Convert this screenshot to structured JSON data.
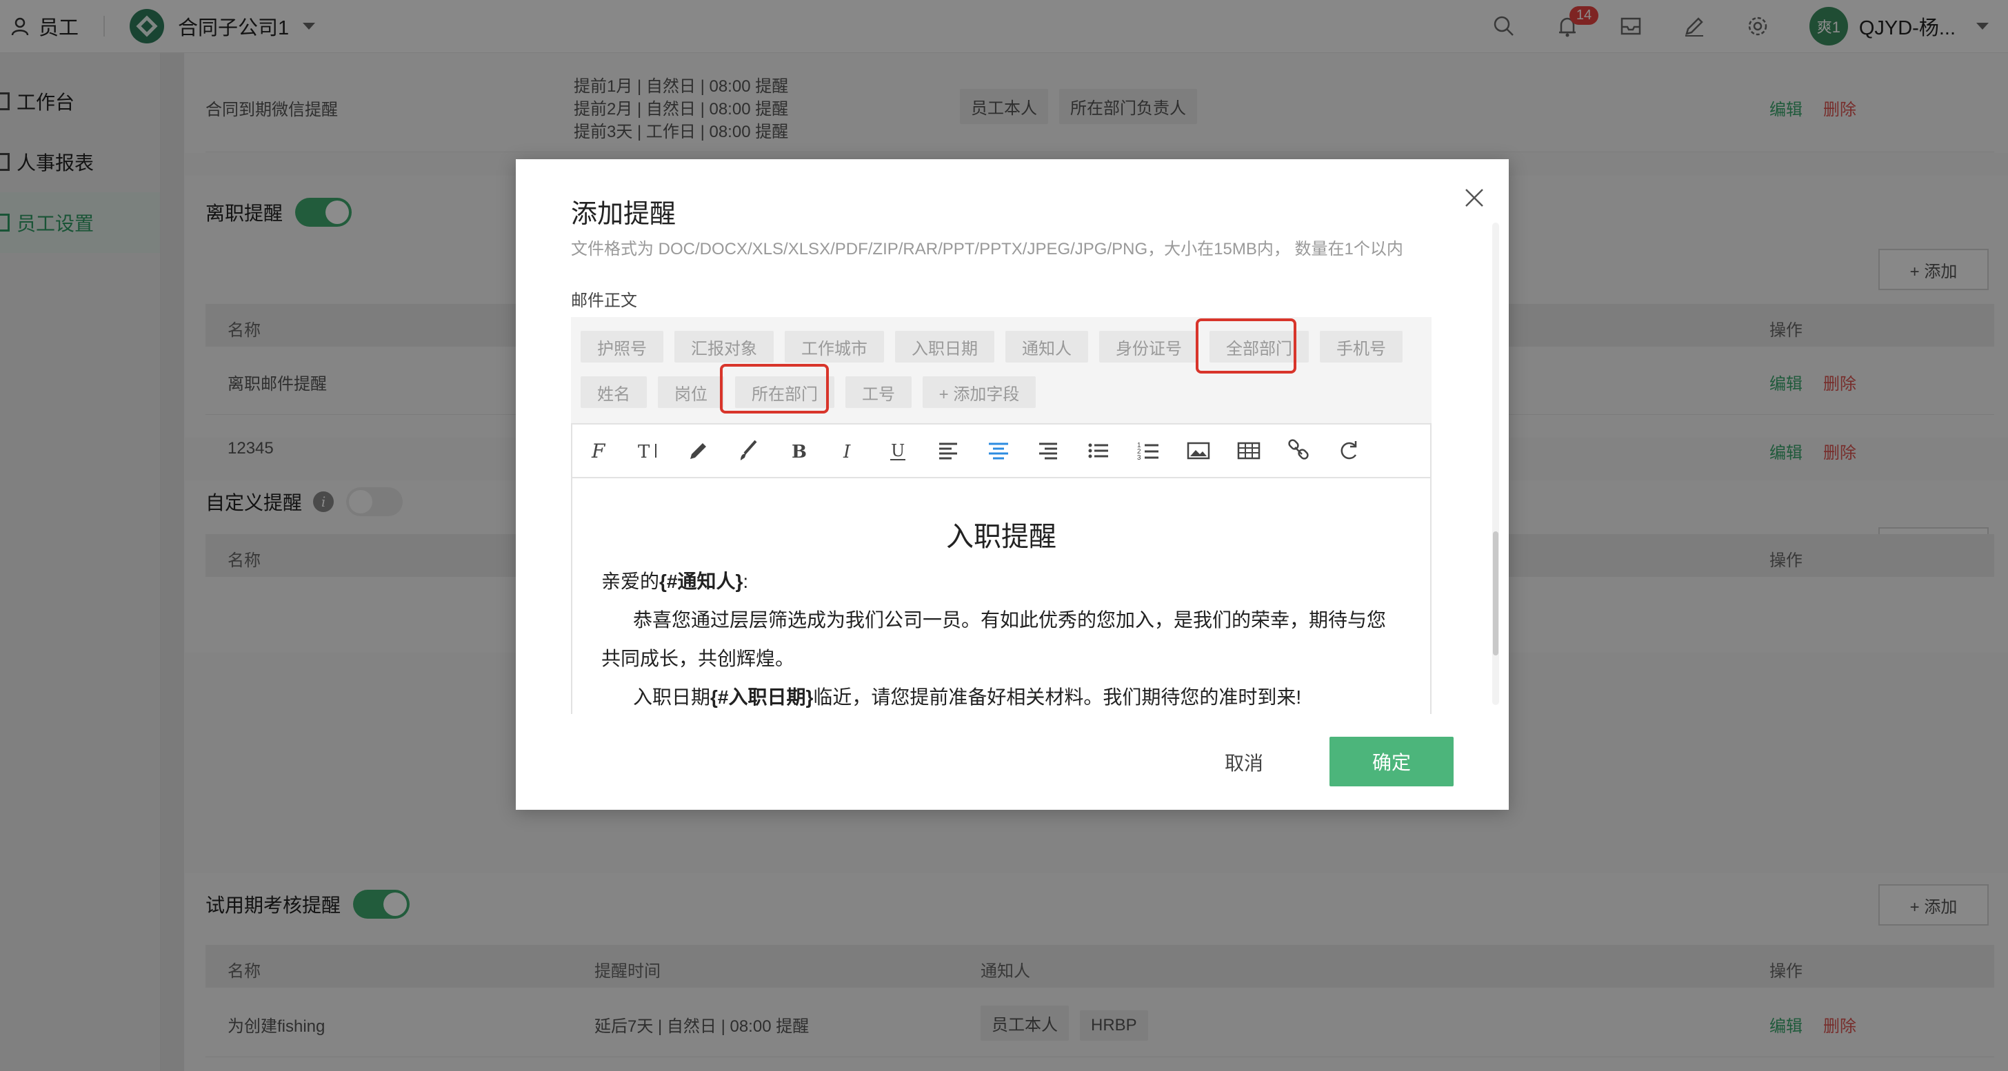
{
  "topbar": {
    "app_title": "员工",
    "company_name": "合同子公司1",
    "notification_count": "14",
    "avatar_text": "爽1",
    "user_name": "QJYD-杨..."
  },
  "sidebar": {
    "items": [
      {
        "label": "工作台"
      },
      {
        "label": "人事报表"
      },
      {
        "label": "员工设置"
      }
    ]
  },
  "bg": {
    "contract_row": {
      "name": "合同到期微信提醒",
      "times": [
        "提前1月 | 自然日 | 08:00 提醒",
        "提前2月 | 自然日 | 08:00 提醒",
        "提前3天 | 工作日 | 08:00 提醒"
      ],
      "tags": [
        "员工本人",
        "所在部门负责人"
      ]
    },
    "actions": {
      "edit": "编辑",
      "delete": "删除"
    },
    "add_label": "+ 添加",
    "resign": {
      "title": "离职提醒",
      "col_name": "名称",
      "col_action": "操作",
      "rows": [
        {
          "name": "离职邮件提醒"
        },
        {
          "name": "12345"
        }
      ]
    },
    "custom": {
      "title": "自定义提醒",
      "info": "i",
      "col_name": "名称",
      "col_action": "操作"
    },
    "probation": {
      "title": "试用期考核提醒",
      "col_name": "名称",
      "col_time": "提醒时间",
      "col_notify": "通知人",
      "col_action": "操作",
      "row": {
        "name": "为创建fishing",
        "time": "延后7天 | 自然日 | 08:00 提醒",
        "tags": [
          "员工本人",
          "HRBP"
        ]
      }
    }
  },
  "modal": {
    "title": "添加提醒",
    "hint": "文件格式为 DOC/DOCX/XLS/XLSX/PDF/ZIP/RAR/PPT/PPTX/JPEG/JPG/PNG，大小在15MB内， 数量在1个以内",
    "body_label": "邮件正文",
    "fields_row1": [
      "护照号",
      "汇报对象",
      "工作城市",
      "入职日期",
      "通知人",
      "身份证号",
      "全部部门",
      "手机号"
    ],
    "fields_row2": [
      "姓名",
      "岗位",
      "所在部门",
      "工号",
      "+ 添加字段"
    ],
    "toolbar_icons": [
      "font-family-icon",
      "font-size-icon",
      "pen-icon",
      "brush-icon",
      "bold-icon",
      "italic-icon",
      "underline-icon",
      "align-left-icon",
      "align-center-icon",
      "align-right-icon",
      "bullet-list-icon",
      "numbered-list-icon",
      "image-icon",
      "table-icon",
      "link-icon",
      "refresh-icon"
    ],
    "editor": {
      "heading": "入职提醒",
      "greeting_prefix": "亲爱的",
      "greeting_var": "{#通知人}",
      "greeting_suffix": ":",
      "para1_line1": "恭喜您通过层层筛选成为我们公司一员。有如此优秀的您加入，是我们的荣幸，期待与您",
      "para1_line2": "共同成长，共创辉煌。",
      "para2_prefix": "入职日期",
      "para2_var": "{#入职日期}",
      "para2_suffix": "临近，请您提前准备好相关材料。我们期待您的准时到来!"
    },
    "cancel": "取消",
    "confirm": "确定"
  },
  "colors": {
    "accent": "#4cb57b",
    "highlight": "#d8352b",
    "danger": "#d9534f"
  }
}
